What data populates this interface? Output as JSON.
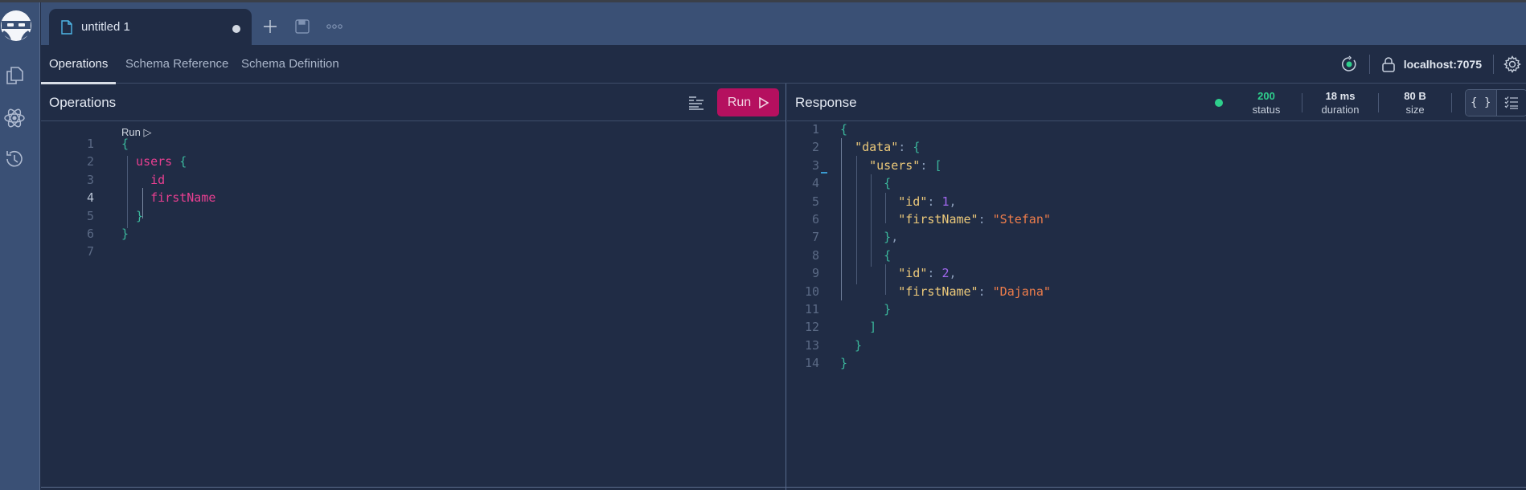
{
  "app": {
    "logo": "ninja-logo",
    "sidebar": [
      {
        "icon": "documents-icon",
        "label": "Documents"
      },
      {
        "icon": "schema-atom-icon",
        "label": "Schemas"
      },
      {
        "icon": "history-icon",
        "label": "History"
      }
    ]
  },
  "tabbar": {
    "tabs": [
      {
        "label": "untitled 1",
        "icon": "file-icon",
        "unsaved": true
      }
    ],
    "actions": [
      "plus-icon",
      "save-icon",
      "more-icon"
    ]
  },
  "subnav": {
    "tabs": [
      {
        "label": "Operations",
        "active": true
      },
      {
        "label": "Schema Reference",
        "active": false
      },
      {
        "label": "Schema Definition",
        "active": false
      }
    ],
    "connection": {
      "status_icon": "refresh-connected-icon",
      "lock_icon": "lock-icon",
      "endpoint": "localhost:7075",
      "settings_icon": "gear-icon"
    }
  },
  "operations": {
    "title": "Operations",
    "run_label": "Run",
    "codelens": "Run ▷",
    "lines": [
      {
        "n": "1",
        "tokens": [
          {
            "t": "{",
            "c": "p"
          }
        ]
      },
      {
        "n": "2",
        "tokens": [
          {
            "t": "  users ",
            "c": "f"
          },
          {
            "t": "{",
            "c": "p"
          }
        ]
      },
      {
        "n": "3",
        "tokens": [
          {
            "t": "    id",
            "c": "f"
          }
        ]
      },
      {
        "n": "4",
        "tokens": [
          {
            "t": "    firstName",
            "c": "f"
          }
        ]
      },
      {
        "n": "5",
        "tokens": [
          {
            "t": "  }",
            "c": "p"
          }
        ]
      },
      {
        "n": "6",
        "tokens": [
          {
            "t": "}",
            "c": "p"
          }
        ]
      },
      {
        "n": "7",
        "tokens": []
      }
    ],
    "current_line": "4"
  },
  "response": {
    "title": "Response",
    "status": {
      "value": "200",
      "label": "status",
      "color": "#2ecf8c"
    },
    "duration": {
      "value": "18 ms",
      "label": "duration"
    },
    "size": {
      "value": "80 B",
      "label": "size"
    },
    "view_modes": [
      "json-braces-icon",
      "checklist-icon"
    ],
    "lines": [
      {
        "n": "1",
        "tokens": [
          {
            "t": "{",
            "c": "p"
          }
        ]
      },
      {
        "n": "2",
        "tokens": [
          {
            "t": "  ",
            "c": "pu"
          },
          {
            "t": "\"data\"",
            "c": "k"
          },
          {
            "t": ": ",
            "c": "pu"
          },
          {
            "t": "{",
            "c": "p"
          }
        ]
      },
      {
        "n": "3",
        "tokens": [
          {
            "t": "    ",
            "c": "pu"
          },
          {
            "t": "\"users\"",
            "c": "k"
          },
          {
            "t": ": ",
            "c": "pu"
          },
          {
            "t": "[",
            "c": "p"
          }
        ]
      },
      {
        "n": "4",
        "tokens": [
          {
            "t": "      {",
            "c": "p"
          }
        ]
      },
      {
        "n": "5",
        "tokens": [
          {
            "t": "        ",
            "c": "pu"
          },
          {
            "t": "\"id\"",
            "c": "k"
          },
          {
            "t": ": ",
            "c": "pu"
          },
          {
            "t": "1",
            "c": "n"
          },
          {
            "t": ",",
            "c": "pu"
          }
        ]
      },
      {
        "n": "6",
        "tokens": [
          {
            "t": "        ",
            "c": "pu"
          },
          {
            "t": "\"firstName\"",
            "c": "k"
          },
          {
            "t": ": ",
            "c": "pu"
          },
          {
            "t": "\"Stefan\"",
            "c": "s"
          }
        ]
      },
      {
        "n": "7",
        "tokens": [
          {
            "t": "      }",
            "c": "p"
          },
          {
            "t": ",",
            "c": "pu"
          }
        ]
      },
      {
        "n": "8",
        "tokens": [
          {
            "t": "      {",
            "c": "p"
          }
        ]
      },
      {
        "n": "9",
        "tokens": [
          {
            "t": "        ",
            "c": "pu"
          },
          {
            "t": "\"id\"",
            "c": "k"
          },
          {
            "t": ": ",
            "c": "pu"
          },
          {
            "t": "2",
            "c": "n"
          },
          {
            "t": ",",
            "c": "pu"
          }
        ]
      },
      {
        "n": "10",
        "tokens": [
          {
            "t": "        ",
            "c": "pu"
          },
          {
            "t": "\"firstName\"",
            "c": "k"
          },
          {
            "t": ": ",
            "c": "pu"
          },
          {
            "t": "\"Dajana\"",
            "c": "s"
          }
        ]
      },
      {
        "n": "11",
        "tokens": [
          {
            "t": "      }",
            "c": "p"
          }
        ]
      },
      {
        "n": "12",
        "tokens": [
          {
            "t": "    ]",
            "c": "p"
          }
        ]
      },
      {
        "n": "13",
        "tokens": [
          {
            "t": "  }",
            "c": "p"
          }
        ]
      },
      {
        "n": "14",
        "tokens": [
          {
            "t": "}",
            "c": "p"
          }
        ]
      }
    ]
  }
}
